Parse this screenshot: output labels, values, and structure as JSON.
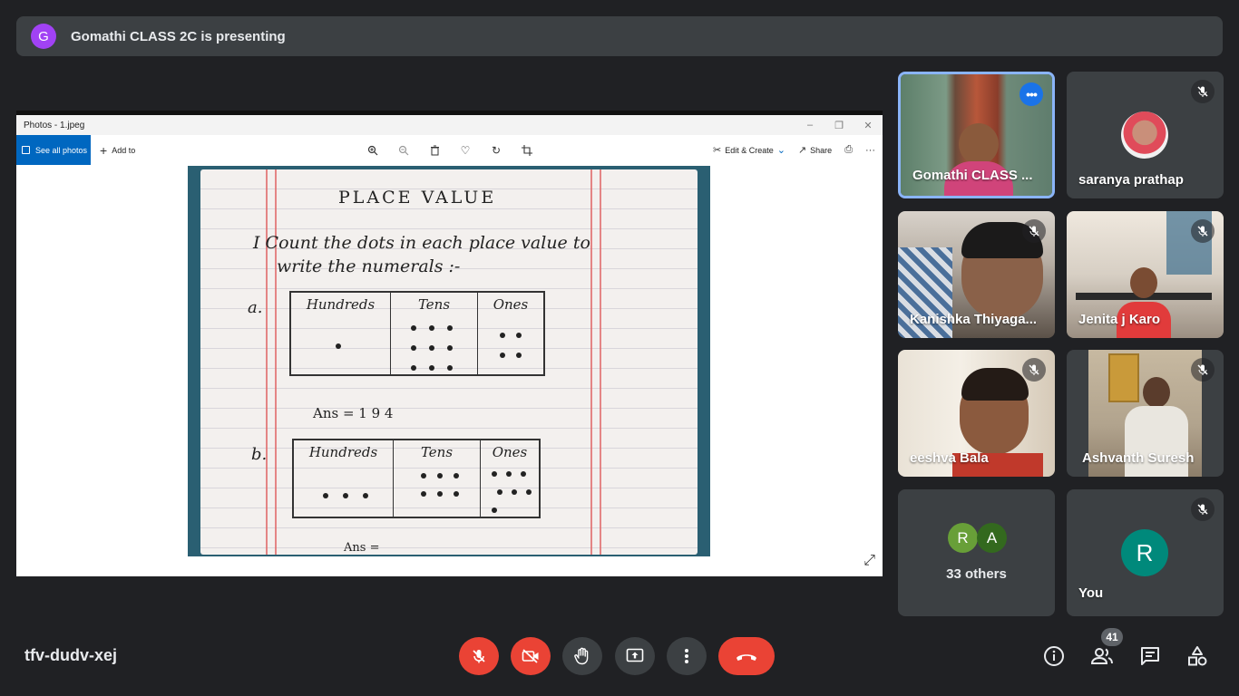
{
  "banner": {
    "avatar_letter": "G",
    "text": "Gomathi CLASS 2C is presenting"
  },
  "photos_app": {
    "window_title": "Photos - 1.jpeg",
    "see_all": "See all photos",
    "add_to": "Add to",
    "edit_create": "Edit & Create",
    "share": "Share"
  },
  "worksheet": {
    "title": "PLACE VALUE",
    "instruction_line1": "I  Count  the  dots  in  each  place  value  to",
    "instruction_line2": "write  the  numerals :-",
    "part_a": "a.",
    "part_b": "b.",
    "columns": [
      "Hundreds",
      "Tens",
      "Ones"
    ],
    "answer_a": "Ans = 1 9 4",
    "answer_b": "Ans ="
  },
  "participants": [
    {
      "name": "Gomathi CLASS ...",
      "state": "presenter"
    },
    {
      "name": "saranya prathap",
      "state": "muted"
    },
    {
      "name": "Kanishka Thiyaga...",
      "state": "muted"
    },
    {
      "name": "Jenita j Karo",
      "state": "muted"
    },
    {
      "name": "eeshva Bala",
      "state": "muted"
    },
    {
      "name": "Ashvanth Suresh",
      "state": "muted"
    },
    {
      "name": "33 others",
      "avatars": [
        "R",
        "A"
      ]
    },
    {
      "name": "You",
      "avatar": "R",
      "state": "muted"
    }
  ],
  "bottom_bar": {
    "meeting_code": "tfv-dudv-xej",
    "people_count": "41"
  },
  "colors": {
    "background": "#202124",
    "tile": "#3c4043",
    "danger": "#ea4335",
    "active_border": "#8ab4f8",
    "presenter_avatar": "#a142f4",
    "you_avatar": "#00897b"
  }
}
